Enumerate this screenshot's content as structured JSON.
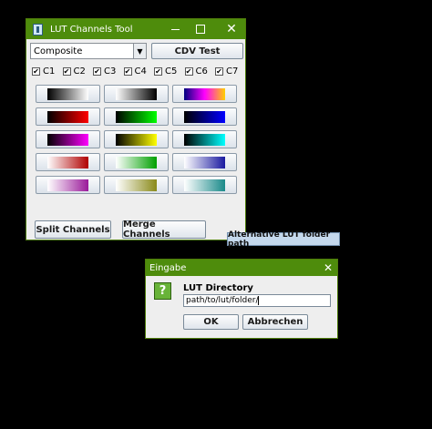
{
  "main_window": {
    "title": "LUT Channels Tool",
    "composite_select": "Composite",
    "cdv_test_label": "CDV Test",
    "channels": [
      {
        "label": "C1",
        "checked": true
      },
      {
        "label": "C2",
        "checked": true
      },
      {
        "label": "C3",
        "checked": true
      },
      {
        "label": "C4",
        "checked": true
      },
      {
        "label": "C5",
        "checked": true
      },
      {
        "label": "C6",
        "checked": true
      },
      {
        "label": "C7",
        "checked": true
      }
    ],
    "luts": [
      [
        "#000000",
        "#ffffff",
        "gray"
      ],
      [
        "#ffffff",
        "#000000",
        "inverted-gray"
      ],
      [
        "#000080",
        "#ff00ff",
        "#ffd000",
        "fire"
      ],
      [
        "#000000",
        "#ff0000",
        "red"
      ],
      [
        "#000000",
        "#00ff00",
        "green"
      ],
      [
        "#000000",
        "#0000ff",
        "blue"
      ],
      [
        "#000000",
        "#ff00ff",
        "magenta"
      ],
      [
        "#000000",
        "#ffff00",
        "yellow"
      ],
      [
        "#000000",
        "#00ffff",
        "cyan"
      ],
      [
        "#ffffff",
        "#b00000",
        "inverted-red"
      ],
      [
        "#ffffff",
        "#00a000",
        "inverted-green"
      ],
      [
        "#ffffff",
        "#1a1aa0",
        "inverted-blue"
      ],
      [
        "#ffffff",
        "#9a1a9a",
        "inverted-magenta"
      ],
      [
        "#ffffff",
        "#8a8a1a",
        "inverted-yellow"
      ],
      [
        "#ffffff",
        "#1a8a8a",
        "inverted-cyan"
      ]
    ],
    "split_label": "Split Channels",
    "merge_label": "Merge Channels"
  },
  "floater_label": "Alternative LUT folder path",
  "dialog": {
    "title": "Eingabe",
    "icon": "question-icon",
    "icon_glyph": "?",
    "label": "LUT Directory",
    "input_value": "path/to/lut/folder/",
    "ok_label": "OK",
    "cancel_label": "Abbrechen"
  },
  "colors": {
    "titlebar": "#4e8c0c",
    "window_bg": "#eeeeee"
  }
}
